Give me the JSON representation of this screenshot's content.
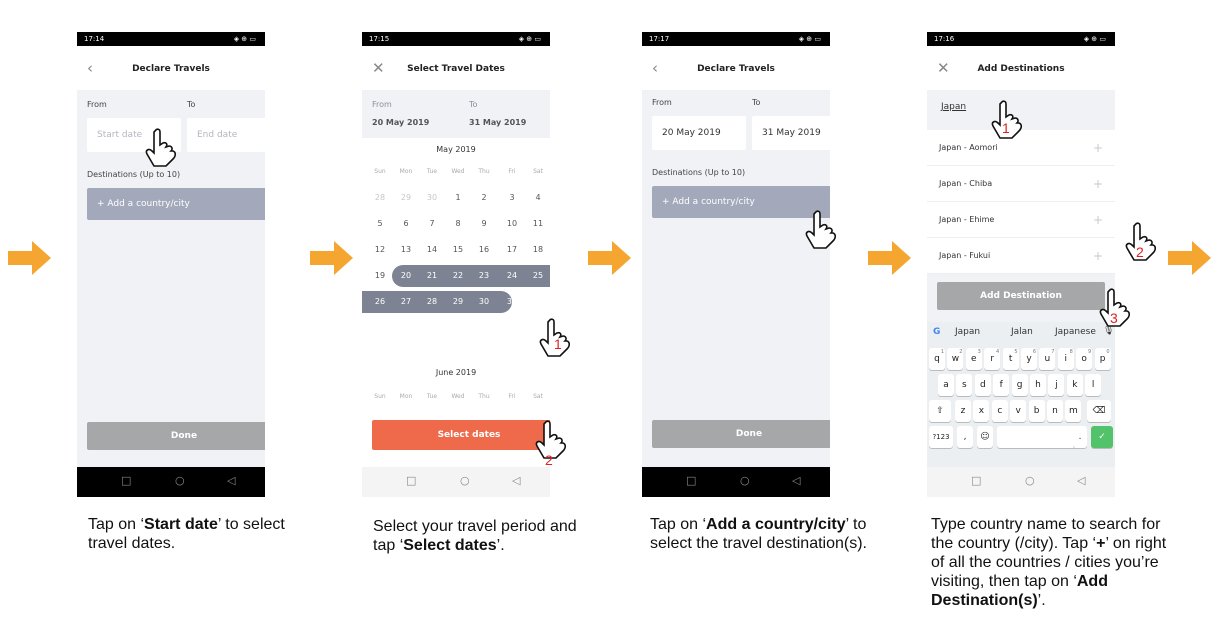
{
  "screens": [
    {
      "status": {
        "time": "17:14",
        "icons": "◈ ⊕ ▭"
      },
      "title": "Declare Travels",
      "from_label": "From",
      "to_label": "To",
      "start_placeholder": "Start date",
      "end_placeholder": "End date",
      "destinations_label": "Destinations (Up to 10)",
      "add_label": "+  Add a country/city",
      "done_label": "Done"
    },
    {
      "status": {
        "time": "17:15",
        "icons": "◈ ⊕ ▭"
      },
      "title": "Select Travel Dates",
      "from_label": "From",
      "to_label": "To",
      "from_value": "20 May 2019",
      "to_value": "31 May 2019",
      "month1": "May 2019",
      "weekdays": [
        "Sun",
        "Mon",
        "Tue",
        "Wed",
        "Thu",
        "Fri",
        "Sat"
      ],
      "rows": [
        [
          "28",
          "29",
          "30",
          "1",
          "2",
          "3",
          "4"
        ],
        [
          "5",
          "6",
          "7",
          "8",
          "9",
          "10",
          "11"
        ],
        [
          "12",
          "13",
          "14",
          "15",
          "16",
          "17",
          "18"
        ],
        [
          "19",
          "20",
          "21",
          "22",
          "23",
          "24",
          "25"
        ],
        [
          "26",
          "27",
          "28",
          "29",
          "30",
          "31",
          ""
        ]
      ],
      "month2": "June 2019",
      "select_label": "Select dates"
    },
    {
      "status": {
        "time": "17:17",
        "icons": "◈ ⊕ ▭"
      },
      "title": "Declare Travels",
      "from_label": "From",
      "to_label": "To",
      "from_value": "20 May 2019",
      "to_value": "31 May 2019",
      "destinations_label": "Destinations (Up to 10)",
      "add_label": "+  Add a country/city",
      "done_label": "Done"
    },
    {
      "status": {
        "time": "17:16",
        "icons": "◈ ⊕ ▭"
      },
      "title": "Add Destinations",
      "search_value": "Japan",
      "results": [
        "Japan - Aomori",
        "Japan - Chiba",
        "Japan - Ehime",
        "Japan - Fukui"
      ],
      "plus_label": "+",
      "add_dest_label": "Add Destination",
      "suggestions": [
        "Japan",
        "Jalan",
        "Japanese"
      ],
      "kb_row1": [
        "q",
        "w",
        "e",
        "r",
        "t",
        "y",
        "u",
        "i",
        "o",
        "p"
      ],
      "kb_row1_hints": [
        "1",
        "2",
        "3",
        "4",
        "5",
        "6",
        "7",
        "8",
        "9",
        "0"
      ],
      "kb_row2": [
        "a",
        "s",
        "d",
        "f",
        "g",
        "h",
        "j",
        "k",
        "l"
      ],
      "kb_row3": [
        "z",
        "x",
        "c",
        "v",
        "b",
        "n",
        "m"
      ],
      "kb_symbols": "?123",
      "kb_comma": ",",
      "kb_period": "."
    }
  ],
  "captions": {
    "c1_pre": "Tap on ‘",
    "c1_bold": "Start date",
    "c1_post": "’ to select travel dates.",
    "c2_pre": "Select your travel period and tap ‘",
    "c2_bold": "Select dates",
    "c2_post": "’.",
    "c3_pre": "Tap on ‘",
    "c3_bold": "Add a country/city",
    "c3_post": "’ to select the travel destination(s).",
    "c4_a": "Type country name to search for the country (/city). Tap ‘",
    "c4_b": "+",
    "c4_c": "’ on right of all the countries / cities you’re visiting, then tap on ‘",
    "c4_d": "Add Destination(s)",
    "c4_e": "’."
  },
  "step_numbers": {
    "s2a": "1",
    "s2b": "2",
    "s4a": "1",
    "s4b": "2",
    "s4c": "3"
  },
  "colors": {
    "arrow": "#f5a631",
    "select_button": "#ee6a4a",
    "range": "#7d8393",
    "add_button": "#a3a9ba",
    "confirm_key": "#52c36b"
  }
}
